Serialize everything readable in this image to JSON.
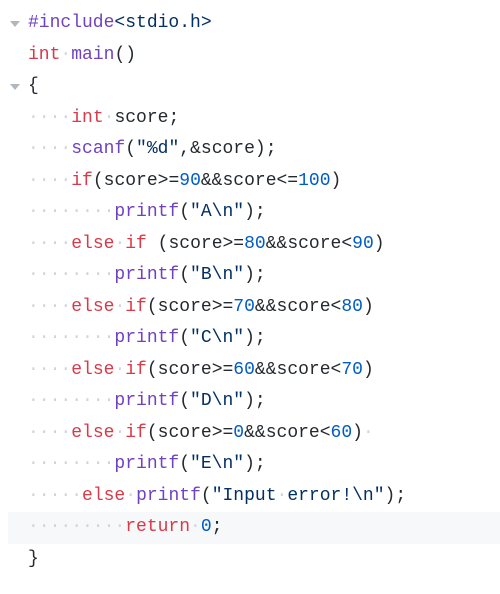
{
  "code": {
    "include_kw": "#include",
    "include_hdr": "<stdio.h>",
    "int_kw": "int",
    "main_fn": "main",
    "paren_open": "(",
    "paren_close": ")",
    "brace_open": "{",
    "brace_close": "}",
    "score_decl": "score",
    "semicolon": ";",
    "scanf_fn": "scanf",
    "scanf_fmt": "\"%d\"",
    "comma": ",",
    "amp": "&",
    "if_kw": "if",
    "else_kw": "else",
    "gte": ">=",
    "lt": "<",
    "lte": "<=",
    "andand": "&&",
    "n90": "90",
    "n100": "100",
    "n80": "80",
    "n70": "70",
    "n60": "60",
    "n0": "0",
    "printf_fn": "printf",
    "str_A": "\"A\\n\"",
    "str_B": "\"B\\n\"",
    "str_C": "\"C\\n\"",
    "str_D": "\"D\\n\"",
    "str_E": "\"E\\n\"",
    "str_err": "\"Input",
    "str_err2": "error!\\n\"",
    "return_kw": "return",
    "dot": "·",
    "ws4": "····",
    "ws8": "········",
    "ws9": "·········",
    "sp": " "
  }
}
